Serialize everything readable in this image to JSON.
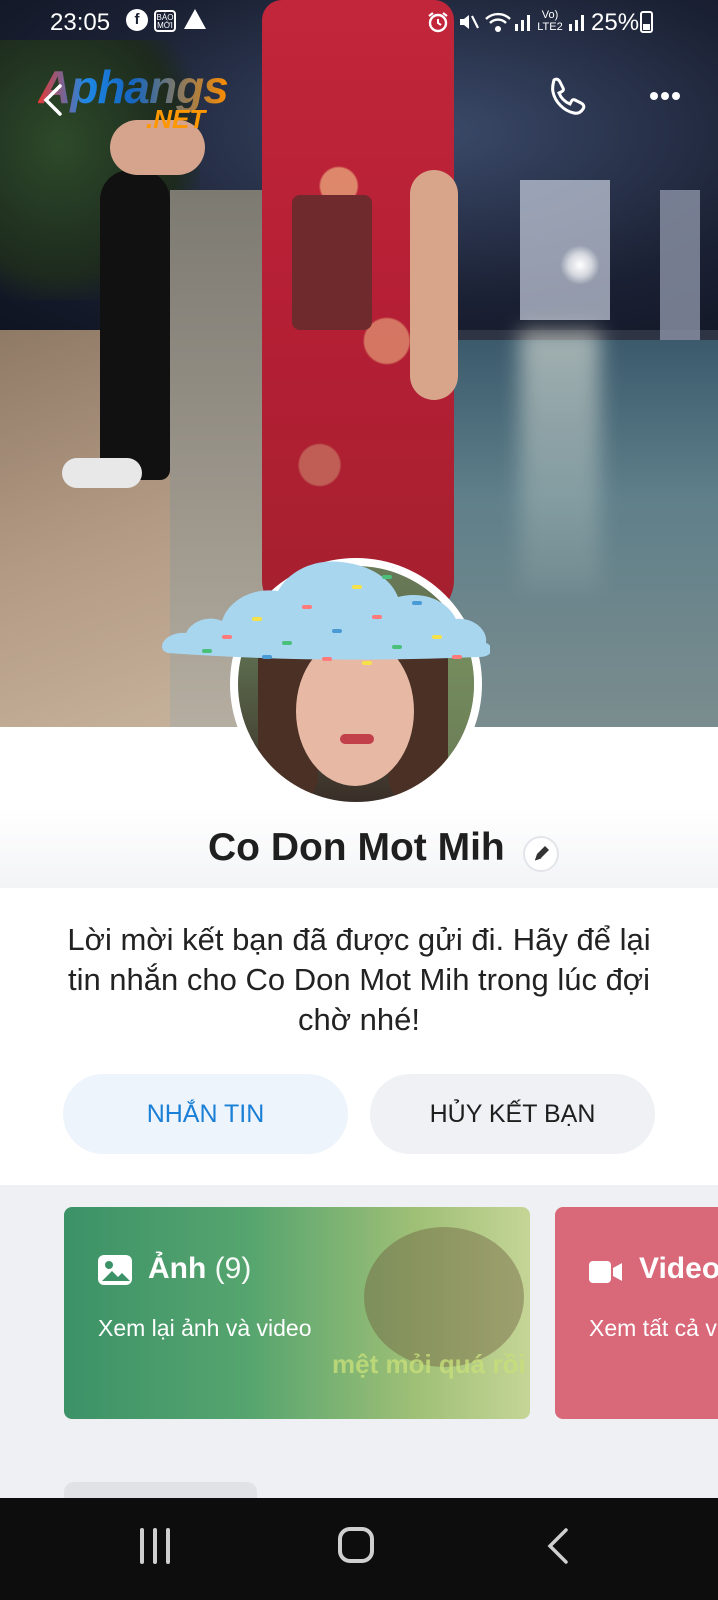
{
  "status_bar": {
    "time": "23:05",
    "app_icons": [
      "facebook-icon",
      "bao-moi-icon",
      "drive-icon"
    ],
    "bao_moi_label": "BÁO MỚI",
    "right_icons": [
      "alarm-icon",
      "mute-icon",
      "wifi-icon",
      "signal-icon",
      "volte-icon",
      "signal-icon"
    ],
    "volte_label": "Vo) LTE2",
    "battery": "25%"
  },
  "watermark": {
    "line1": "Aphangs",
    "line2": ".NET"
  },
  "header": {
    "back_icon": "chevron-left-icon",
    "call_icon": "phone-icon",
    "more_icon": "more-dots-icon"
  },
  "profile": {
    "name": "Co Don Mot Mih",
    "edit_icon": "pencil-icon"
  },
  "message": "Lời mời kết bạn đã được gửi đi. Hãy để lại tin nhắn cho Co Don Mot Mih trong lúc đợi chờ nhé!",
  "actions": {
    "message_label": "NHẮN TIN",
    "unfriend_label": "HỦY KẾT BẠN"
  },
  "cards": [
    {
      "icon": "image-icon",
      "title": "Ảnh",
      "count": "(9)",
      "subtitle": "Xem lại ảnh và video",
      "overlay_text": "mệt mỏi quá rồi",
      "color": "#3c9267"
    },
    {
      "icon": "video-camera-icon",
      "title": "Video",
      "subtitle": "Xem tất cả video",
      "color": "#d96879"
    }
  ],
  "navbar": {
    "recents_icon": "recents-icon",
    "home_icon": "home-icon",
    "back_icon": "back-icon"
  },
  "colors": {
    "accent": "#1a7fd6",
    "message_button_bg": "#edf4fb",
    "unfriend_button_bg": "#f0f1f4"
  }
}
